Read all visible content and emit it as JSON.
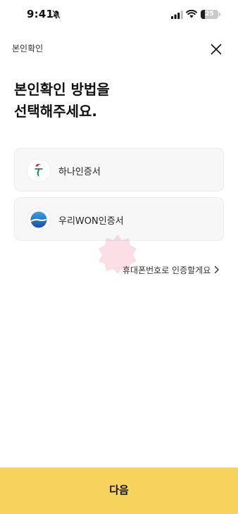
{
  "status_bar": {
    "time": "9:41",
    "battery_level": "25",
    "battery_fraction": 0.25
  },
  "header": {
    "title": "본인확인",
    "close_icon": "close-icon"
  },
  "main": {
    "title_lines": [
      "본인확인 방법을",
      "선택해주세요."
    ]
  },
  "methods": [
    {
      "label": "하나인증서",
      "icon": "hana-bank-logo-icon",
      "color": "#1a8a5d"
    },
    {
      "label": "우리WON인증서",
      "icon": "woori-bank-logo-icon",
      "color": "#1e5fb4"
    }
  ],
  "phone_link": {
    "label": "휴대폰번호로 인증할게요",
    "icon": "chevron-right-icon"
  },
  "footer": {
    "next_label": "다음",
    "accent_color": "#f5d35c"
  }
}
